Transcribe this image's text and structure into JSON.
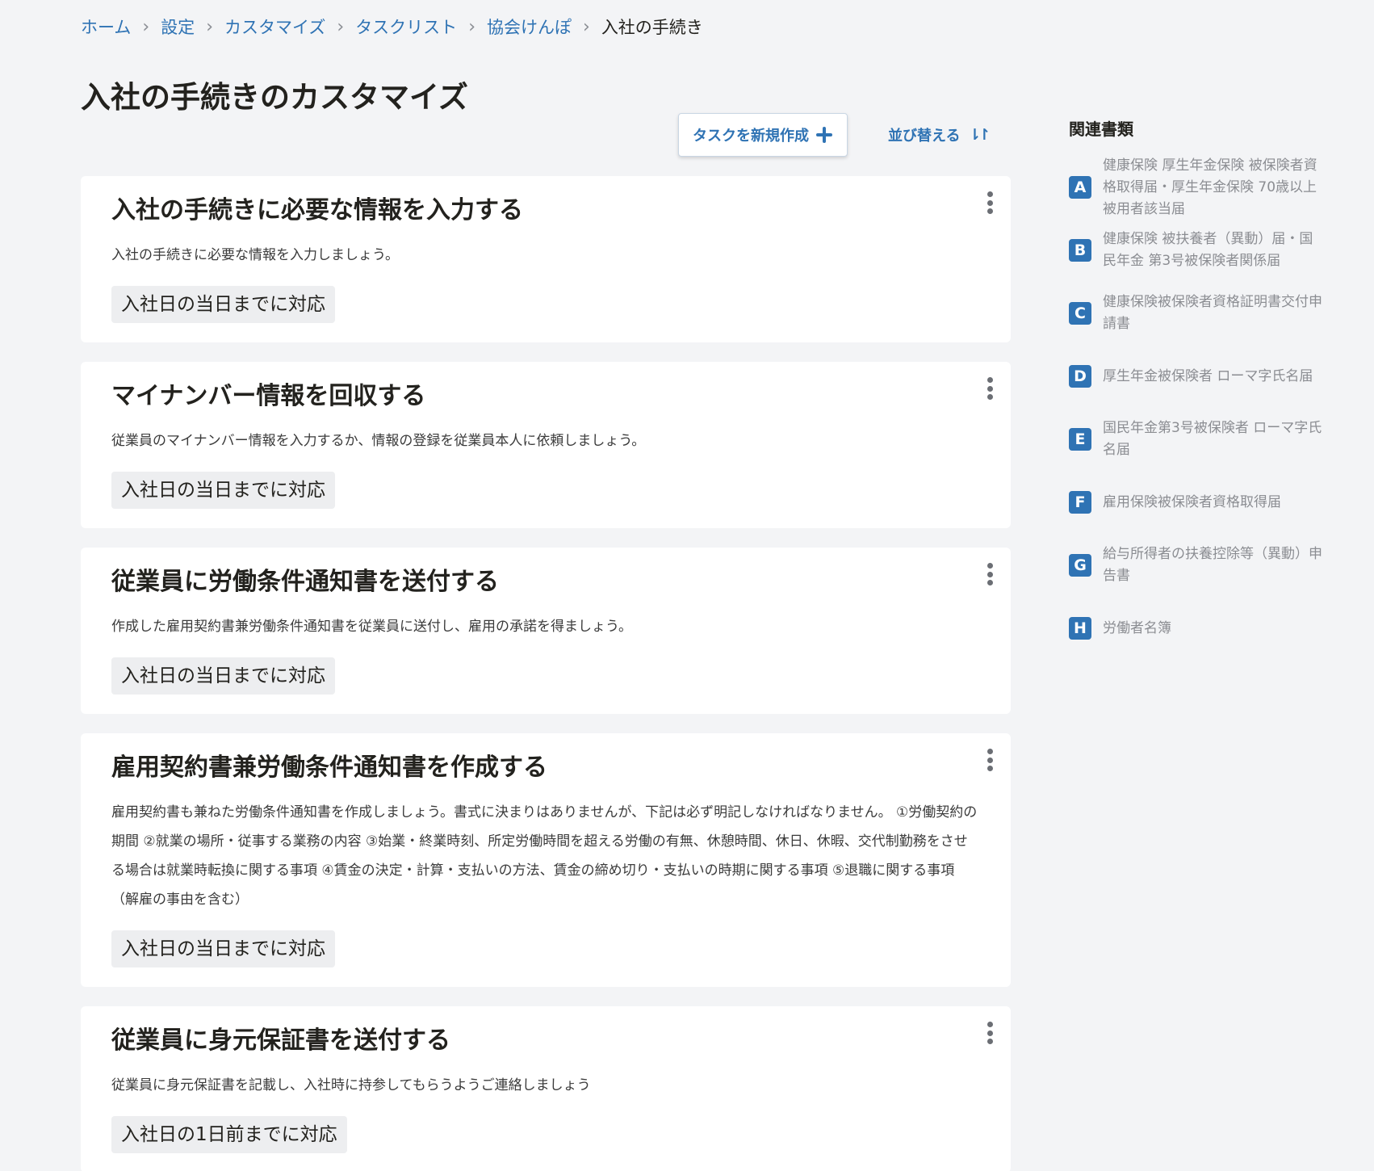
{
  "breadcrumb": {
    "items": [
      "ホーム",
      "設定",
      "カスタマイズ",
      "タスクリスト",
      "協会けんぽ"
    ],
    "current": "入社の手続き"
  },
  "page": {
    "title": "入社の手続きのカスタマイズ"
  },
  "toolbar": {
    "new_task_label": "タスクを新規作成",
    "sort_label": "並び替える",
    "sort_icon": "⇂↾"
  },
  "tasks": [
    {
      "title": "入社の手続きに必要な情報を入力する",
      "description": "入社の手続きに必要な情報を入力しましょう。",
      "deadline": "入社日の当日までに対応"
    },
    {
      "title": "マイナンバー情報を回収する",
      "description": "従業員のマイナンバー情報を入力するか、情報の登録を従業員本人に依頼しましょう。",
      "deadline": "入社日の当日までに対応"
    },
    {
      "title": "従業員に労働条件通知書を送付する",
      "description": "作成した雇用契約書兼労働条件通知書を従業員に送付し、雇用の承諾を得ましょう。",
      "deadline": "入社日の当日までに対応"
    },
    {
      "title": "雇用契約書兼労働条件通知書を作成する",
      "description": "雇用契約書も兼ねた労働条件通知書を作成しましょう。書式に決まりはありませんが、下記は必ず明記しなければなりません。 ①労働契約の期間 ②就業の場所・従事する業務の内容 ③始業・終業時刻、所定労働時間を超える労働の有無、休憩時間、休日、休暇、交代制勤務をさせる場合は就業時転換に関する事項 ④賃金の決定・計算・支払いの方法、賃金の締め切り・支払いの時期に関する事項 ⑤退職に関する事項（解雇の事由を含む）",
      "deadline": "入社日の当日までに対応"
    },
    {
      "title": "従業員に身元保証書を送付する",
      "description": "従業員に身元保証書を記載し、入社時に持参してもらうようご連絡しましょう",
      "deadline": "入社日の1日前までに対応"
    }
  ],
  "sidebar": {
    "title": "関連書類",
    "documents": [
      {
        "badge": "A",
        "label": "健康保険 厚生年金保険 被保険者資格取得届・厚生年金保険 70歳以上被用者該当届"
      },
      {
        "badge": "B",
        "label": "健康保険 被扶養者（異動）届・国民年金 第3号被保険者関係届"
      },
      {
        "badge": "C",
        "label": "健康保険被保険者資格証明書交付申請書"
      },
      {
        "badge": "D",
        "label": "厚生年金被保険者 ローマ字氏名届"
      },
      {
        "badge": "E",
        "label": "国民年金第3号被保険者 ローマ字氏名届"
      },
      {
        "badge": "F",
        "label": "雇用保険被保険者資格取得届"
      },
      {
        "badge": "G",
        "label": "給与所得者の扶養控除等（異動）申告書"
      },
      {
        "badge": "H",
        "label": "労働者名簿"
      }
    ]
  },
  "colors": {
    "accent": "#2f73b4",
    "background": "#f3f4f6",
    "card": "#ffffff",
    "muted_text": "#8b8d92"
  }
}
